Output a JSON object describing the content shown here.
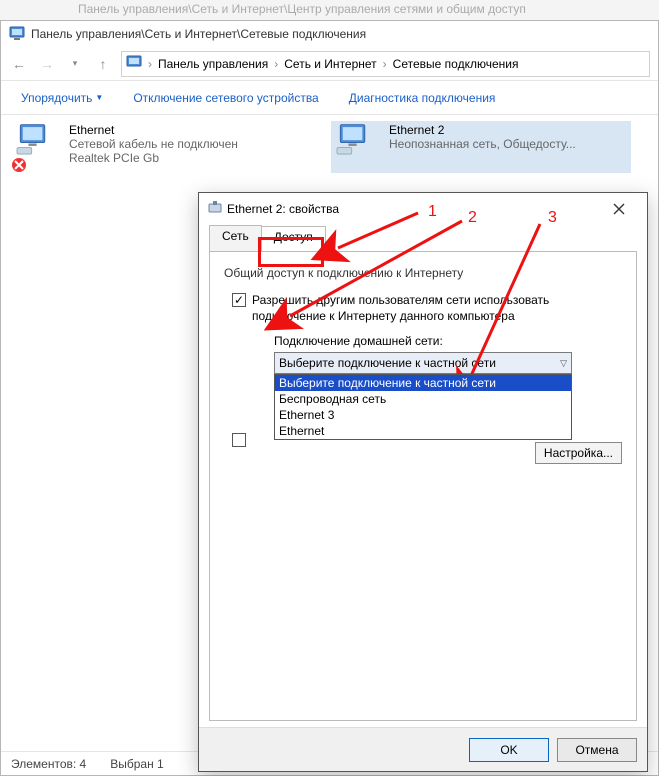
{
  "faded_bg_title": "Панель управления\\Сеть и Интернет\\Центр управления сетями и общим доступ",
  "explorer": {
    "title": "Панель управления\\Сеть и Интернет\\Сетевые подключения",
    "breadcrumbs": [
      "Панель управления",
      "Сеть и Интернет",
      "Сетевые подключения"
    ],
    "commands": {
      "organize": "Упорядочить",
      "disable": "Отключение сетевого устройства",
      "diagnose": "Диагностика подключения"
    },
    "adapters": [
      {
        "name": "Ethernet",
        "status": "Сетевой кабель не подключен",
        "device": "Realtek PCIe Gb"
      },
      {
        "name": "Ethernet 2",
        "status": "Неопознанная сеть, Общедосту...",
        "device": ""
      }
    ],
    "statusbar": {
      "elements": "Элементов: 4",
      "selected": "Выбран 1"
    }
  },
  "dialog": {
    "title": "Ethernet 2: свойства",
    "tabs": {
      "net": "Сеть",
      "access": "Доступ"
    },
    "group_label": "Общий доступ к подключению к Интернету",
    "allow_label": "Разрешить другим пользователям сети использовать подключение к Интернету данного компьютера",
    "home_net_label": "Подключение домашней сети:",
    "combo_selected": "Выберите подключение к частной сети",
    "combo_options": [
      "Выберите подключение к частной сети",
      "Беспроводная сеть",
      "Ethernet 3",
      "Ethernet"
    ],
    "settings_btn": "Настройка...",
    "ok": "OK",
    "cancel": "Отмена"
  },
  "annotations": {
    "n1": "1",
    "n2": "2",
    "n3": "3"
  }
}
